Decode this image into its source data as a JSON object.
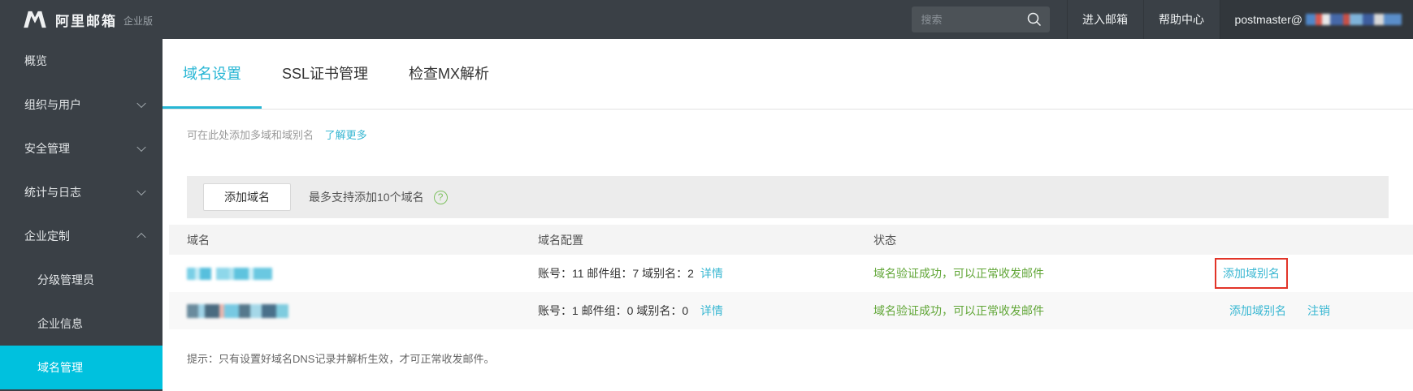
{
  "topbar": {
    "product_name": "阿里邮箱",
    "edition_badge": "企业版",
    "search_placeholder": "搜索",
    "enter_mailbox_label": "进入邮箱",
    "help_center_label": "帮助中心",
    "account_email_prefix": "postmaster@"
  },
  "sidebar": {
    "items": [
      {
        "label": "概览"
      },
      {
        "label": "组织与用户",
        "expandable": true,
        "state": "collapsed"
      },
      {
        "label": "安全管理",
        "expandable": true,
        "state": "collapsed"
      },
      {
        "label": "统计与日志",
        "expandable": true,
        "state": "collapsed"
      },
      {
        "label": "企业定制",
        "expandable": true,
        "state": "expanded"
      },
      {
        "label": "分级管理员",
        "sub_item": true
      },
      {
        "label": "企业信息",
        "sub_item": true
      },
      {
        "label": "域名管理",
        "sub_item": true,
        "active": true
      }
    ]
  },
  "tabs": [
    {
      "label": "域名设置",
      "active": true
    },
    {
      "label": "SSL证书管理",
      "active": false
    },
    {
      "label": "检查MX解析",
      "active": false
    }
  ],
  "intro": {
    "text": "可在此处添加多域和域别名",
    "link_label": "了解更多"
  },
  "toolbar": {
    "add_domain_label": "添加域名",
    "limit_text": "最多支持添加10个域名",
    "help_icon_glyph": "?"
  },
  "domain_table": {
    "headers": [
      "域名",
      "域名配置",
      "状态"
    ],
    "rows": [
      {
        "domain_redacted": true,
        "config": "账号：11 邮件组：7 域别名：2",
        "details_label": "详情",
        "status": "域名验证成功，可以正常收发邮件",
        "action_add_alias": "添加域别名",
        "action_highlighted": true
      },
      {
        "domain_redacted": true,
        "config": "账号：1 邮件组：0 域别名：0",
        "details_label": "详情",
        "status": "域名验证成功，可以正常收发邮件",
        "action_add_alias": "添加域别名",
        "action_deregister": "注销"
      }
    ]
  },
  "tip": "提示：只有设置好域名DNS记录并解析生效，才可正常收发邮件。",
  "colors": {
    "accent_cyan": "#00c1de",
    "link_cyan": "#39b7d2",
    "success_green": "#61a637",
    "danger_red": "#f2584a",
    "highlight_box_red": "#e23428",
    "topbar_dark": "#3a4046"
  }
}
